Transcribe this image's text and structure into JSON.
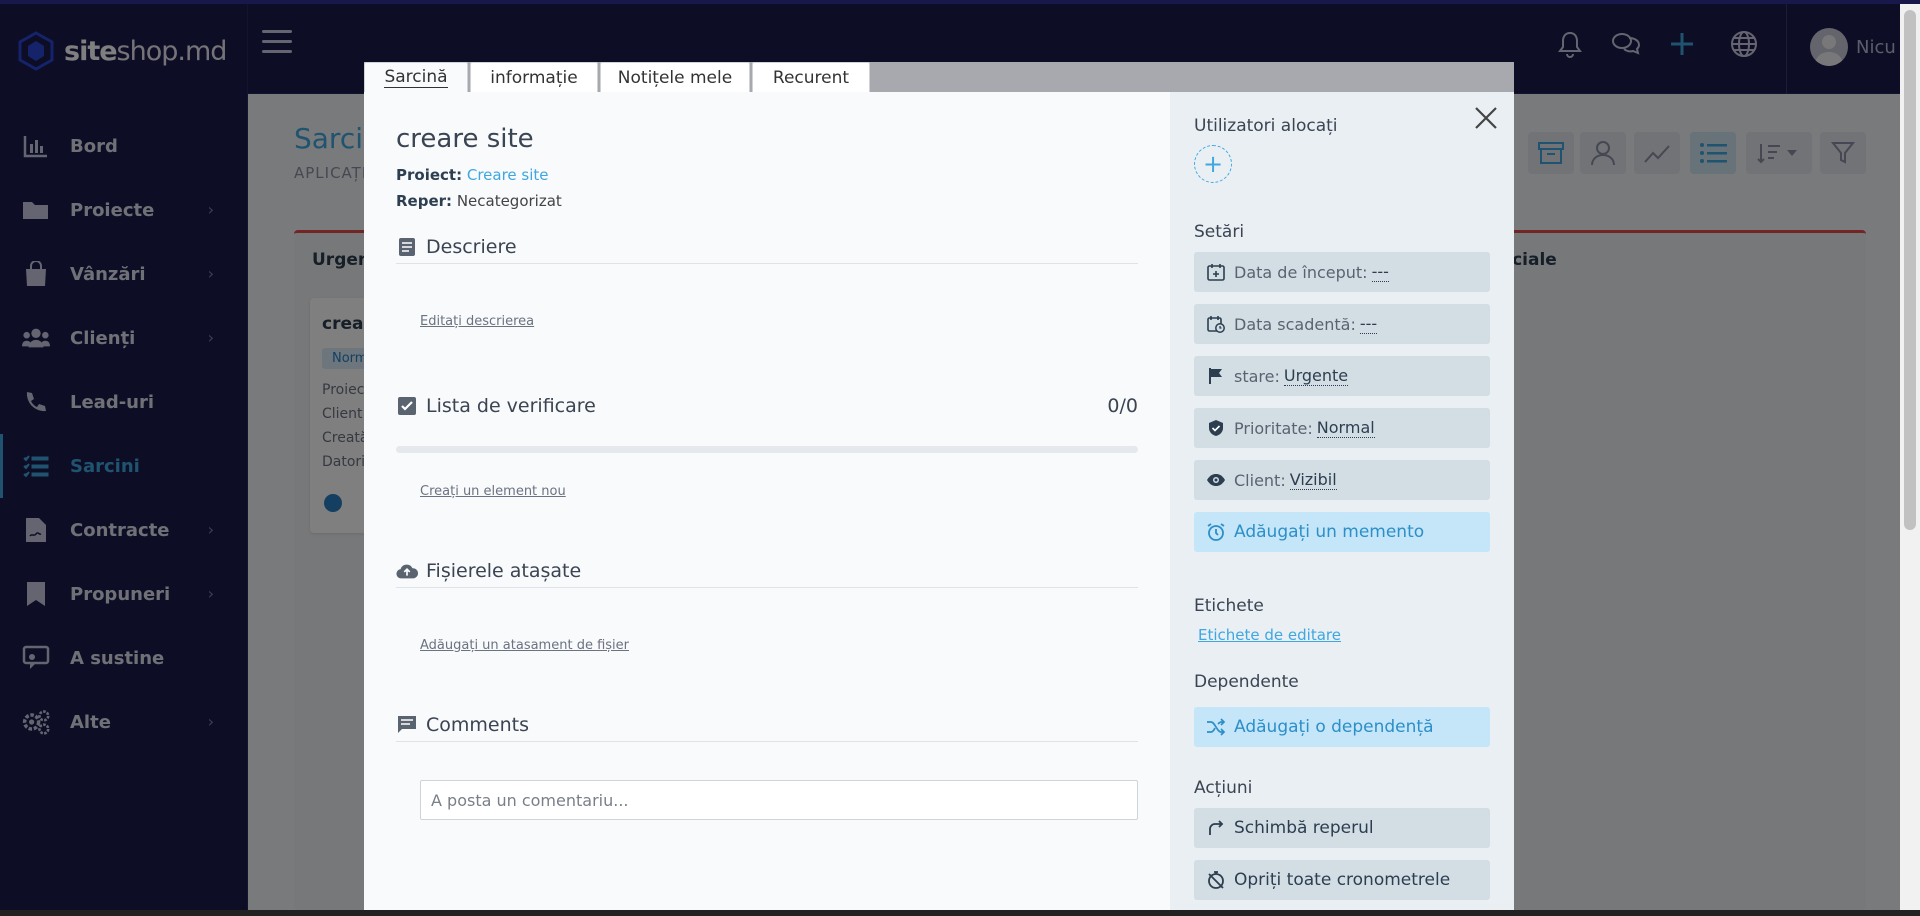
{
  "app": {
    "logo_bold": "site",
    "logo_rest": "shop.md",
    "username": "Nicu"
  },
  "sidebar": {
    "items": [
      {
        "label": "Bord",
        "icon": "chart-bar-icon",
        "chevron": false
      },
      {
        "label": "Proiecte",
        "icon": "folder-icon",
        "chevron": true
      },
      {
        "label": "Vânzări",
        "icon": "shopping-bag-icon",
        "chevron": true
      },
      {
        "label": "Clienți",
        "icon": "users-icon",
        "chevron": true
      },
      {
        "label": "Lead-uri",
        "icon": "phone-icon",
        "chevron": false
      },
      {
        "label": "Sarcini",
        "icon": "tasks-icon",
        "chevron": false,
        "active": true
      },
      {
        "label": "Contracte",
        "icon": "contract-icon",
        "chevron": true
      },
      {
        "label": "Propuneri",
        "icon": "bookmark-icon",
        "chevron": true
      },
      {
        "label": "A sustine",
        "icon": "support-chat-icon",
        "chevron": false
      },
      {
        "label": "Alte",
        "icon": "cogs-icon",
        "chevron": true
      }
    ]
  },
  "background_page": {
    "title": "Sarcini",
    "subtitle": "APLICAȚI",
    "column_left": "Urgen",
    "column_right": "uciale",
    "card": {
      "title": "crear",
      "badge": "Norm",
      "lines": [
        "Proiec",
        "Client",
        "Creată",
        "Datori"
      ]
    }
  },
  "modal": {
    "tabs": [
      {
        "label": "Sarcină",
        "active": true
      },
      {
        "label": "informație",
        "active": false
      },
      {
        "label": "Notițele mele",
        "active": false
      },
      {
        "label": "Recurent",
        "active": false
      }
    ],
    "task_title": "creare site",
    "project_label": "Proiect:",
    "project_value": "Creare site",
    "milestone_label": "Reper:",
    "milestone_value": "Necategorizat",
    "description": {
      "heading": "Descriere",
      "edit_link": "Editați descrierea"
    },
    "checklist": {
      "heading": "Lista de verificare",
      "count": "0/0",
      "progress": 0,
      "create_link": "Creați un element nou"
    },
    "attachments": {
      "heading": "Fișierele atașate",
      "add_link": "Adăugați un atasament de fișier"
    },
    "comments": {
      "heading": "Comments",
      "placeholder": "A posta un comentariu..."
    },
    "right": {
      "assigned_heading": "Utilizatori alocați",
      "settings_heading": "Setări",
      "start_date_label": "Data de început:",
      "start_date_value": "---",
      "due_date_label": "Data scadentă:",
      "due_date_value": "---",
      "status_label": "stare:",
      "status_value": "Urgente",
      "priority_label": "Prioritate:",
      "priority_value": "Normal",
      "client_label": "Client:",
      "client_value": "Vizibil",
      "reminder_button": "Adăugați un memento",
      "tags_heading": "Etichete",
      "tags_link": "Etichete de editare",
      "dependencies_heading": "Dependente",
      "dependency_button": "Adăugați o dependență",
      "actions_heading": "Acțiuni",
      "change_milestone": "Schimbă reperul",
      "stop_timers": "Opriți toate cronometrele"
    }
  },
  "colors": {
    "sidebar_bg": "#1b1a4a",
    "accent": "#3fa7e0",
    "urgent": "#e24a4a"
  }
}
